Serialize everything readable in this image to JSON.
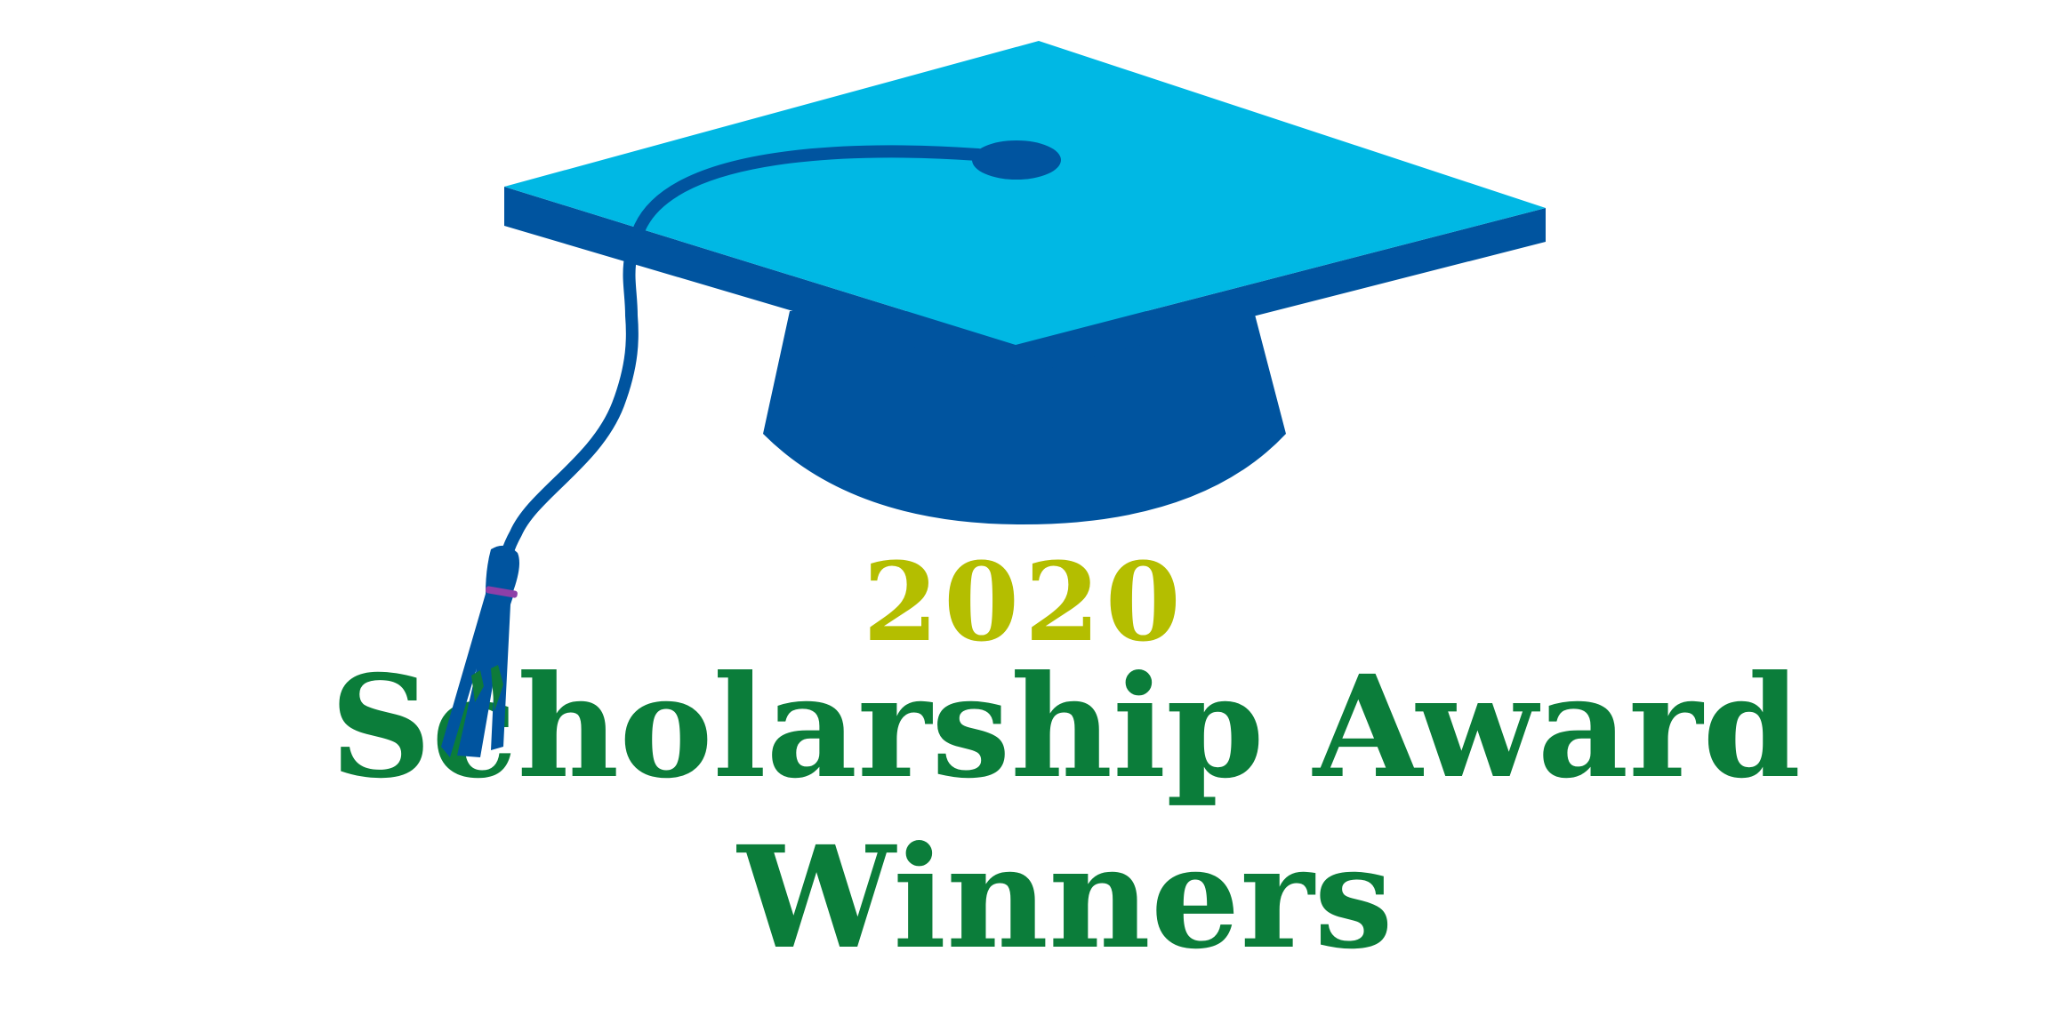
{
  "graphic": {
    "icon": "graduation-cap-icon",
    "colors": {
      "cap_top": "#00B8E4",
      "cap_dark": "#00549F",
      "tassel_band": "#8E3FA8",
      "tassel_accent": "#0E7A3A",
      "year_color": "#B4BE00",
      "title_color": "#0B7D3A"
    }
  },
  "announcement": {
    "year": "2020",
    "title_line1": "Scholarship Award",
    "title_line2": "Winners"
  }
}
